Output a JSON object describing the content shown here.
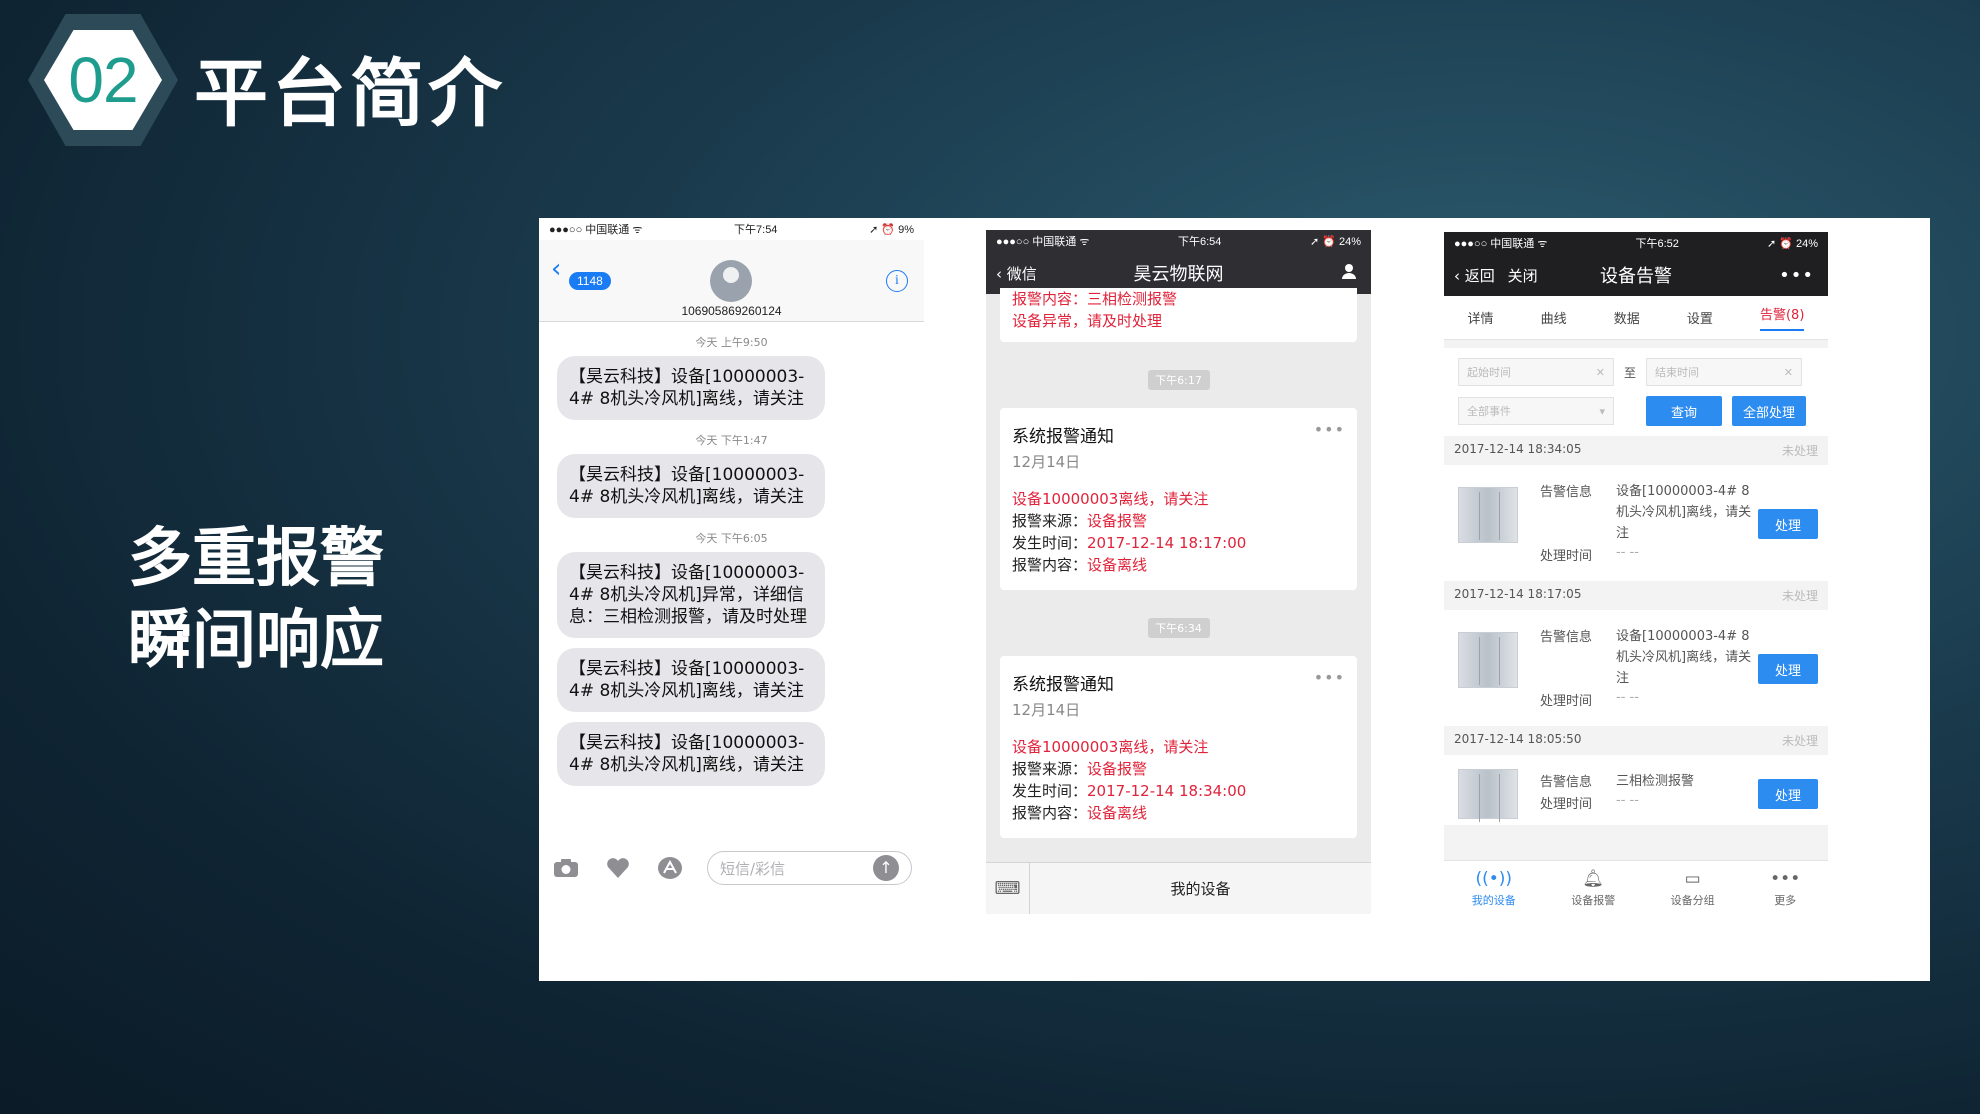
{
  "header": {
    "badge_number": "02",
    "title": "平台简介"
  },
  "side_text": {
    "line1": "多重报警",
    "line2": "瞬间响应"
  },
  "sms": {
    "status": {
      "carrier": "●●●○○ 中国联通 ᯤ",
      "time": "下午7:54",
      "battery": "➚ ⏰ 9%"
    },
    "back_count": "1148",
    "contact_number": "106905869260124",
    "info": "i",
    "messages": [
      {
        "time": "今天 上午9:50",
        "text": "【昊云科技】设备[10000003-4# 8机头冷风机]离线，请关注"
      },
      {
        "time": "今天 下午1:47",
        "text": "【昊云科技】设备[10000003-4# 8机头冷风机]离线，请关注"
      },
      {
        "time": "今天 下午6:05",
        "text": "【昊云科技】设备[10000003-4# 8机头冷风机]异常，详细信息：三相检测报警，请及时处理"
      },
      {
        "time": "",
        "text": "【昊云科技】设备[10000003-4# 8机头冷风机]离线，请关注"
      },
      {
        "time": "",
        "text": "【昊云科技】设备[10000003-4# 8机头冷风机]离线，请关注"
      }
    ],
    "input_placeholder": "短信/彩信"
  },
  "wechat": {
    "status": {
      "carrier": "●●●○○ 中国联通 ᯤ",
      "time": "下午6:54",
      "battery": "➚ ⏰ 24%"
    },
    "back_label": "微信",
    "title": "昊云物联网",
    "top_partial": {
      "line1": "报警内容：三相检测报警",
      "line2": "设备异常，请及时处理"
    },
    "cards": [
      {
        "pill": "下午6:17",
        "title": "系统报警通知",
        "date": "12月14日",
        "headline": "设备10000003离线，请关注",
        "source_label": "报警来源：",
        "source": "设备报警",
        "time_label": "发生时间：",
        "time": "2017-12-14 18:17:00",
        "content_label": "报警内容：",
        "content": "设备离线"
      },
      {
        "pill": "下午6:34",
        "title": "系统报警通知",
        "date": "12月14日",
        "headline": "设备10000003离线，请关注",
        "source_label": "报警来源：",
        "source": "设备报警",
        "time_label": "发生时间：",
        "time": "2017-12-14 18:34:00",
        "content_label": "报警内容：",
        "content": "设备离线"
      }
    ],
    "bottom_label": "我的设备"
  },
  "app": {
    "status": {
      "carrier": "●●●○○ 中国联通 ᯤ",
      "time": "下午6:52",
      "battery": "➚ ⏰ 24%"
    },
    "back_label": "返回",
    "close_label": "关闭",
    "title": "设备告警",
    "tabs": [
      "详情",
      "曲线",
      "数据",
      "设置",
      "告警(8)"
    ],
    "filter": {
      "start_placeholder": "起始时间",
      "to_label": "至",
      "end_placeholder": "结束时间",
      "event_select": "全部事件",
      "query_label": "查询",
      "process_all_label": "全部处理"
    },
    "alarms": [
      {
        "datetime": "2017-12-14 18:34:05",
        "status": "未处理",
        "info_label": "告警信息",
        "info": "设备[10000003-4# 8机头冷风机]离线，请关注",
        "time_label": "处理时间",
        "time": "-- --",
        "button": "处理"
      },
      {
        "datetime": "2017-12-14 18:17:05",
        "status": "未处理",
        "info_label": "告警信息",
        "info": "设备[10000003-4# 8机头冷风机]离线，请关注",
        "time_label": "处理时间",
        "time": "-- --",
        "button": "处理"
      },
      {
        "datetime": "2017-12-14 18:05:50",
        "status": "未处理",
        "info_label": "告警信息",
        "info": "三相检测报警",
        "time_label": "处理时间",
        "time": "-- --",
        "button": "处理"
      }
    ],
    "tabbar": [
      "我的设备",
      "设备报警",
      "设备分组",
      "更多"
    ]
  },
  "colors": {
    "accent_teal": "#1e9c8e",
    "alert_red": "#e0233a",
    "ios_blue": "#1a7cf5",
    "app_blue": "#2d8cf0"
  }
}
